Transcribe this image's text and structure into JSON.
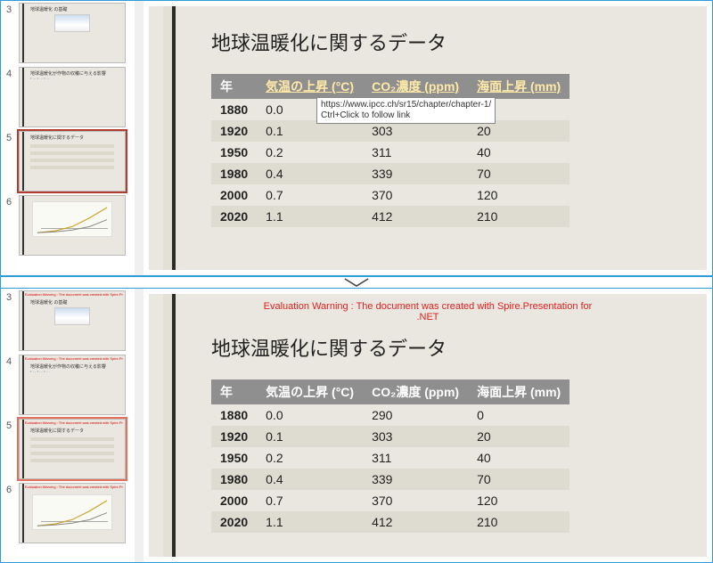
{
  "thumbs": {
    "numbers": [
      "3",
      "4",
      "5",
      "6"
    ],
    "slide3_title": "地球温暖化\nの基礎",
    "slide4_title": "地球温暖化が作物の収穫に与える影響",
    "slide4_bullets": "• …\n• …\n• …",
    "slide5_title": "地球温暖化に関するデータ",
    "slide6_title": ""
  },
  "slide": {
    "title": "地球温暖化に関するデータ",
    "headers": {
      "year": "年",
      "temp": "気温の上昇 (°C)",
      "co2": "CO₂濃度 (ppm)",
      "sea": "海面上昇 (mm)"
    },
    "rows": [
      {
        "year": "1880",
        "temp": "0.0",
        "co2": "290",
        "sea": "0"
      },
      {
        "year": "1920",
        "temp": "0.1",
        "co2": "303",
        "sea": "20"
      },
      {
        "year": "1950",
        "temp": "0.2",
        "co2": "311",
        "sea": "40"
      },
      {
        "year": "1980",
        "temp": "0.4",
        "co2": "339",
        "sea": "70"
      },
      {
        "year": "2000",
        "temp": "0.7",
        "co2": "370",
        "sea": "120"
      },
      {
        "year": "2020",
        "temp": "1.1",
        "co2": "412",
        "sea": "210"
      }
    ]
  },
  "tooltip": {
    "url": "https://www.ipcc.ch/sr15/chapter/chapter-1/",
    "hint": "Ctrl+Click to follow link"
  },
  "eval_warning": {
    "line1": "Evaluation Warning : The document was created with  Spire.Presentation for",
    "line2": ".NET"
  },
  "chart_data": {
    "type": "table",
    "title": "地球温暖化に関するデータ",
    "columns": [
      "年",
      "気温の上昇 (°C)",
      "CO₂濃度 (ppm)",
      "海面上昇 (mm)"
    ],
    "rows": [
      [
        1880,
        0.0,
        290,
        0
      ],
      [
        1920,
        0.1,
        303,
        20
      ],
      [
        1950,
        0.2,
        311,
        40
      ],
      [
        1980,
        0.4,
        339,
        70
      ],
      [
        2000,
        0.7,
        370,
        120
      ],
      [
        2020,
        1.1,
        412,
        210
      ]
    ]
  }
}
